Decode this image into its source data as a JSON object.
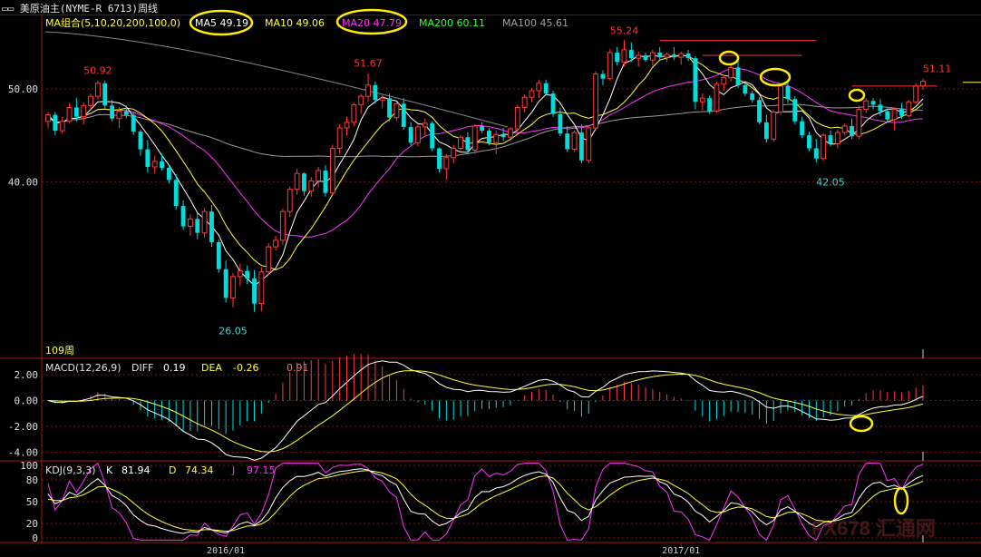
{
  "window": {
    "title": "美原油主(NYME-R 6713)周线"
  },
  "legend": {
    "prefix": "MA组合(5,10,20,200,100,0)",
    "items": [
      {
        "text": "MA5 49.19",
        "color": "#ffffff",
        "circled": true
      },
      {
        "text": "MA10 49.06",
        "color": "#ffff33",
        "circled": false
      },
      {
        "text": "MA20 47.79",
        "color": "#ff33ff",
        "circled": true
      },
      {
        "text": "MA200 60.11",
        "color": "#33ff33",
        "circled": false
      },
      {
        "text": "MA100 45.61",
        "color": "#a0a0a0",
        "circled": false
      }
    ]
  },
  "price_panel": {
    "y_ticks": [
      "50.00",
      "40.00"
    ],
    "period_label": "109周",
    "annotations": [
      {
        "text": "50.92",
        "color": "#ff3333"
      },
      {
        "text": "51.67",
        "color": "#ff3333"
      },
      {
        "text": "55.24",
        "color": "#ff3333"
      },
      {
        "text": "51.11",
        "color": "#ff3333"
      },
      {
        "text": "26.05",
        "color": "#33dddd"
      },
      {
        "text": "42.05",
        "color": "#33dddd"
      }
    ]
  },
  "macd_panel": {
    "header": "MACD(12,26,9)",
    "diff_label": "DIFF",
    "diff_value": "0.19",
    "dea_label": "DEA",
    "dea_value": "-0.26",
    "macd_value": "0.91",
    "y_ticks": [
      "2.00",
      "0.00",
      "-2.00",
      "-4.00"
    ]
  },
  "kdj_panel": {
    "header": "KDJ(9,3,3)",
    "k_label": "K",
    "k_value": "81.94",
    "d_label": "D",
    "d_value": "74.34",
    "j_label": "J",
    "j_value": "97.15",
    "y_ticks": [
      "100",
      "80",
      "50",
      "20",
      "0"
    ]
  },
  "x_axis": {
    "labels": [
      "2016/01",
      "2017/01"
    ]
  },
  "watermark": {
    "text": "FX678 汇通网"
  },
  "chart_data": {
    "type": "candlestick",
    "title": "美原油主(NYME-R 6713)周线",
    "period": "weekly",
    "y_range": [
      21,
      58
    ],
    "y_ticks": [
      40,
      50
    ],
    "x_ticks": [
      "2016/01",
      "2017/01"
    ],
    "ohlc": [
      [
        46.5,
        47.5,
        45.8,
        47.2
      ],
      [
        47.2,
        47.5,
        45.0,
        45.5
      ],
      [
        45.5,
        47.0,
        45.2,
        46.5
      ],
      [
        46.5,
        48.5,
        46.3,
        48.0
      ],
      [
        48.0,
        49.0,
        46.5,
        47.0
      ],
      [
        47.0,
        48.5,
        46.2,
        48.2
      ],
      [
        48.2,
        49.5,
        47.8,
        49.2
      ],
      [
        49.2,
        50.9,
        48.8,
        50.6
      ],
      [
        50.6,
        50.9,
        47.9,
        48.2
      ],
      [
        48.2,
        48.8,
        46.5,
        46.8
      ],
      [
        46.8,
        48.0,
        45.8,
        47.6
      ],
      [
        47.6,
        48.2,
        46.8,
        47.2
      ],
      [
        47.2,
        47.5,
        45.0,
        45.4
      ],
      [
        45.4,
        45.6,
        42.8,
        43.5
      ],
      [
        43.5,
        44.5,
        41.0,
        41.6
      ],
      [
        41.6,
        42.8,
        40.9,
        42.2
      ],
      [
        42.2,
        43.0,
        41.2,
        41.5
      ],
      [
        41.5,
        41.9,
        39.8,
        40.2
      ],
      [
        40.2,
        40.8,
        37.0,
        37.4
      ],
      [
        37.4,
        38.0,
        34.8,
        35.2
      ],
      [
        35.2,
        36.5,
        34.2,
        36.0
      ],
      [
        36.0,
        36.6,
        33.8,
        34.5
      ],
      [
        34.5,
        37.2,
        34.0,
        36.8
      ],
      [
        36.8,
        37.5,
        33.0,
        33.5
      ],
      [
        33.5,
        33.8,
        30.2,
        30.6
      ],
      [
        30.6,
        31.5,
        27.0,
        27.5
      ],
      [
        27.5,
        30.2,
        26.5,
        29.8
      ],
      [
        29.8,
        31.2,
        28.8,
        30.4
      ],
      [
        30.4,
        31.0,
        29.0,
        29.6
      ],
      [
        29.6,
        30.5,
        26.0,
        26.9
      ],
      [
        26.9,
        30.8,
        26.05,
        30.3
      ],
      [
        30.3,
        33.4,
        30.0,
        33.0
      ],
      [
        33.0,
        34.2,
        32.6,
        33.7
      ],
      [
        33.7,
        37.1,
        33.2,
        36.8
      ],
      [
        36.8,
        39.5,
        36.2,
        39.2
      ],
      [
        39.2,
        41.4,
        38.6,
        40.9
      ],
      [
        40.9,
        41.0,
        38.5,
        39.0
      ],
      [
        39.0,
        40.5,
        38.4,
        40.1
      ],
      [
        40.1,
        41.6,
        39.4,
        41.2
      ],
      [
        41.2,
        41.8,
        38.4,
        38.8
      ],
      [
        38.8,
        44.0,
        38.6,
        43.6
      ],
      [
        43.6,
        46.2,
        43.0,
        45.8
      ],
      [
        45.8,
        47.0,
        45.0,
        46.4
      ],
      [
        46.4,
        48.5,
        46.0,
        48.3
      ],
      [
        48.3,
        49.5,
        47.3,
        49.2
      ],
      [
        49.2,
        51.67,
        48.6,
        50.4
      ],
      [
        50.4,
        50.8,
        48.4,
        48.8
      ],
      [
        48.8,
        49.3,
        47.9,
        49.0
      ],
      [
        49.0,
        49.5,
        46.5,
        46.9
      ],
      [
        46.9,
        48.6,
        46.6,
        48.4
      ],
      [
        48.4,
        49.0,
        45.6,
        45.9
      ],
      [
        45.9,
        46.4,
        43.9,
        44.2
      ],
      [
        44.2,
        46.2,
        43.8,
        45.9
      ],
      [
        45.9,
        46.8,
        45.0,
        46.3
      ],
      [
        46.3,
        46.5,
        43.3,
        43.6
      ],
      [
        43.6,
        43.7,
        41.0,
        41.4
      ],
      [
        41.4,
        43.0,
        40.2,
        42.6
      ],
      [
        42.6,
        44.0,
        42.0,
        43.6
      ],
      [
        43.6,
        45.0,
        43.4,
        44.8
      ],
      [
        44.8,
        45.3,
        43.1,
        43.4
      ],
      [
        43.4,
        46.2,
        43.0,
        46.0
      ],
      [
        46.0,
        46.4,
        45.2,
        45.5
      ],
      [
        45.5,
        45.8,
        43.9,
        44.2
      ],
      [
        44.2,
        45.5,
        43.0,
        45.1
      ],
      [
        45.1,
        45.8,
        44.4,
        44.8
      ],
      [
        44.8,
        45.9,
        44.6,
        45.7
      ],
      [
        45.7,
        48.3,
        45.4,
        48.0
      ],
      [
        48.0,
        49.4,
        47.5,
        49.1
      ],
      [
        49.1,
        50.1,
        48.6,
        49.8
      ],
      [
        49.8,
        51.0,
        49.0,
        50.6
      ],
      [
        50.6,
        51.0,
        49.3,
        49.5
      ],
      [
        49.5,
        49.8,
        47.0,
        47.3
      ],
      [
        47.3,
        48.0,
        44.9,
        45.2
      ],
      [
        45.2,
        46.0,
        43.2,
        43.5
      ],
      [
        43.5,
        45.5,
        43.2,
        45.3
      ],
      [
        45.3,
        46.2,
        42.0,
        42.3
      ],
      [
        42.3,
        46.1,
        42.0,
        45.8
      ],
      [
        45.8,
        51.9,
        45.5,
        51.6
      ],
      [
        51.6,
        52.0,
        50.4,
        51.1
      ],
      [
        51.1,
        54.3,
        50.9,
        53.9
      ],
      [
        53.9,
        54.5,
        52.5,
        52.9
      ],
      [
        52.9,
        55.24,
        52.4,
        54.2
      ],
      [
        54.2,
        55.0,
        52.9,
        53.3
      ],
      [
        53.3,
        54.0,
        52.4,
        53.6
      ],
      [
        53.6,
        53.9,
        52.9,
        53.1
      ],
      [
        53.1,
        54.2,
        52.5,
        53.9
      ],
      [
        53.9,
        54.5,
        53.1,
        53.4
      ],
      [
        53.4,
        53.9,
        52.9,
        53.7
      ],
      [
        53.7,
        54.5,
        53.1,
        53.4
      ],
      [
        53.4,
        54.0,
        52.6,
        53.8
      ],
      [
        53.8,
        54.2,
        53.0,
        53.3
      ],
      [
        53.3,
        53.5,
        47.8,
        48.6
      ],
      [
        48.6,
        49.5,
        47.7,
        49.0
      ],
      [
        49.0,
        49.3,
        47.3,
        47.6
      ],
      [
        47.6,
        50.8,
        47.4,
        50.5
      ],
      [
        50.5,
        51.5,
        49.8,
        51.2
      ],
      [
        51.2,
        52.6,
        50.8,
        52.3
      ],
      [
        52.3,
        53.3,
        50.1,
        50.4
      ],
      [
        50.4,
        50.7,
        49.2,
        49.5
      ],
      [
        49.5,
        49.8,
        48.5,
        48.8
      ],
      [
        48.8,
        49.1,
        46.2,
        46.4
      ],
      [
        46.4,
        47.2,
        44.2,
        44.6
      ],
      [
        44.6,
        47.7,
        44.3,
        47.5
      ],
      [
        47.5,
        50.6,
        47.2,
        50.3
      ],
      [
        50.3,
        50.9,
        48.5,
        48.9
      ],
      [
        48.9,
        49.2,
        46.2,
        46.5
      ],
      [
        46.5,
        47.0,
        44.7,
        45.0
      ],
      [
        45.0,
        45.4,
        43.3,
        43.6
      ],
      [
        43.6,
        44.6,
        42.05,
        42.5
      ],
      [
        42.5,
        45.2,
        42.3,
        45.0
      ],
      [
        45.0,
        45.5,
        43.8,
        44.1
      ],
      [
        44.1,
        45.6,
        43.6,
        45.3
      ],
      [
        45.3,
        46.3,
        45.0,
        46.0
      ],
      [
        46.0,
        46.8,
        44.6,
        44.9
      ],
      [
        44.9,
        48.2,
        44.6,
        47.8
      ],
      [
        47.8,
        49.0,
        47.4,
        48.7
      ],
      [
        48.7,
        49.0,
        47.8,
        48.3
      ],
      [
        48.3,
        48.9,
        47.1,
        47.6
      ],
      [
        47.6,
        47.9,
        46.4,
        46.7
      ],
      [
        46.7,
        48.0,
        45.5,
        47.8
      ],
      [
        47.8,
        48.5,
        46.8,
        47.1
      ],
      [
        47.1,
        48.8,
        46.9,
        48.6
      ],
      [
        48.6,
        50.6,
        48.4,
        50.3
      ],
      [
        50.3,
        51.11,
        49.9,
        50.8
      ]
    ],
    "moving_averages": [
      {
        "name": "MA5",
        "value": 49.19
      },
      {
        "name": "MA10",
        "value": 49.06
      },
      {
        "name": "MA20",
        "value": 47.79
      },
      {
        "name": "MA200",
        "value": 60.11
      },
      {
        "name": "MA100",
        "value": 45.61
      }
    ],
    "high_labels": [
      51.67,
      55.24,
      50.92,
      51.11
    ],
    "low_labels": [
      26.05,
      42.05
    ],
    "macd": {
      "params": "12,26,9",
      "DIFF": 0.19,
      "DEA": -0.26,
      "MACD": 0.91,
      "y_range": [
        -4.6,
        3.2
      ],
      "y_ticks": [
        2,
        0,
        -2,
        -4
      ]
    },
    "kdj": {
      "params": "9,3,3",
      "K": 81.94,
      "D": 74.34,
      "J": 97.15,
      "y_range": [
        -5,
        105
      ],
      "y_ticks": [
        100,
        80,
        50,
        20,
        0
      ]
    }
  }
}
